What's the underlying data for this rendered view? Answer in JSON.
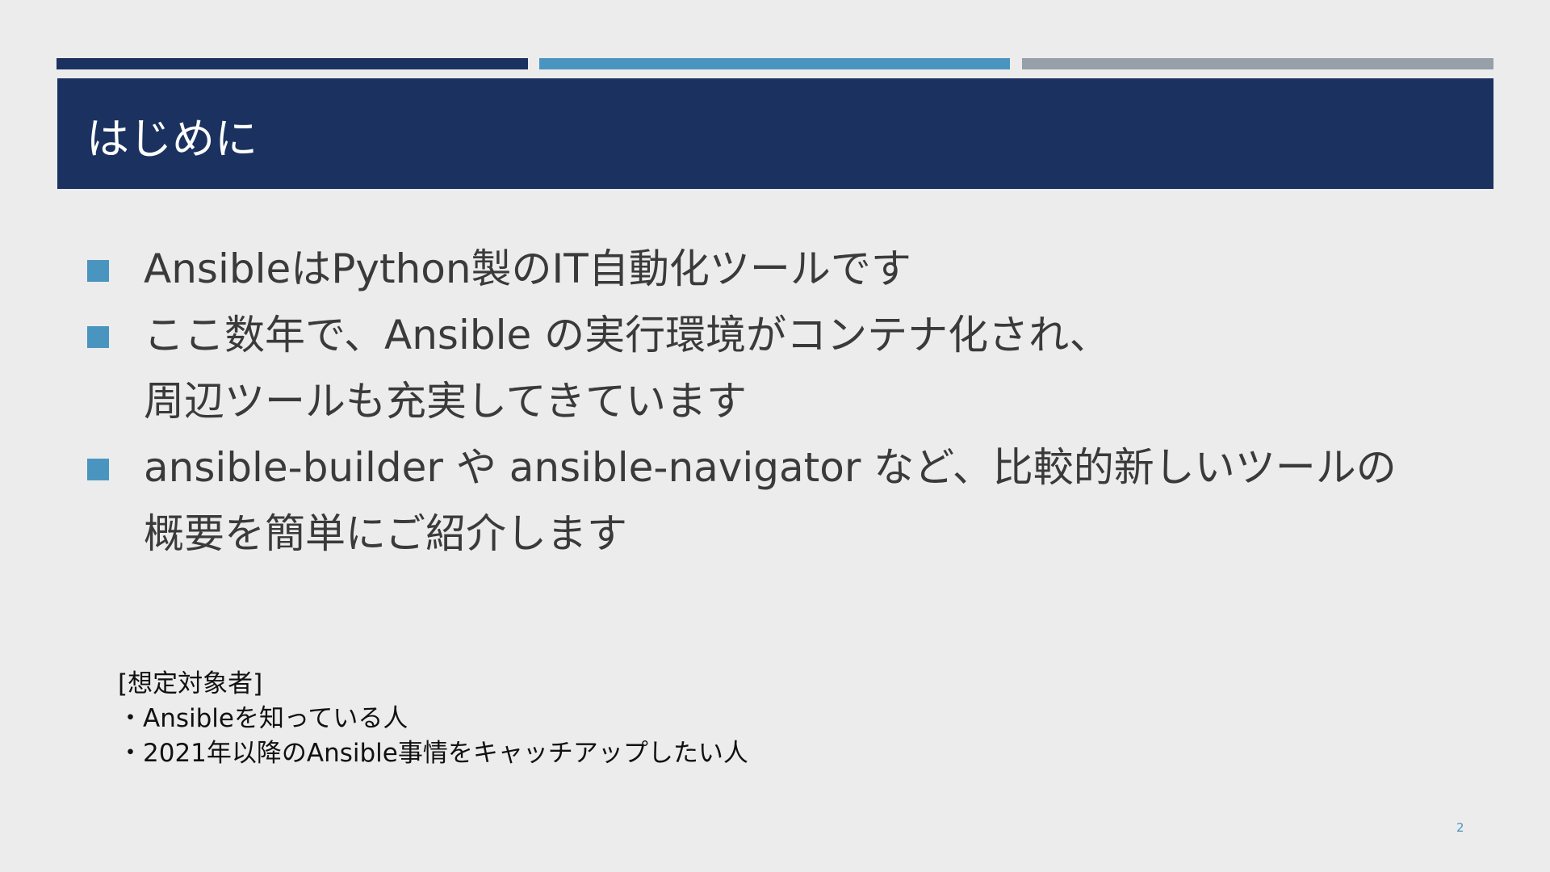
{
  "colors": {
    "background": "#ececec",
    "navy": "#1b3260",
    "accent_blue": "#4a95c0",
    "accent_gray": "#97a0a8",
    "bullet": "#4a95c0",
    "page_number": "#4a95c0"
  },
  "slide": {
    "title": "はじめに",
    "bullets": [
      {
        "lines": [
          "AnsibleはPython製のIT自動化ツールです"
        ]
      },
      {
        "lines": [
          "ここ数年で、Ansible の実行環境がコンテナ化され、",
          "周辺ツールも充実してきています"
        ]
      },
      {
        "lines": [
          "ansible-builder や ansible-navigator など、比較的新しいツールの",
          "概要を簡単にご紹介します"
        ]
      }
    ],
    "audience": {
      "heading": "[想定対象者]",
      "items": [
        "・Ansibleを知っている人",
        "・2021年以降のAnsible事情をキャッチアップしたい人"
      ]
    },
    "page_number": "2"
  }
}
